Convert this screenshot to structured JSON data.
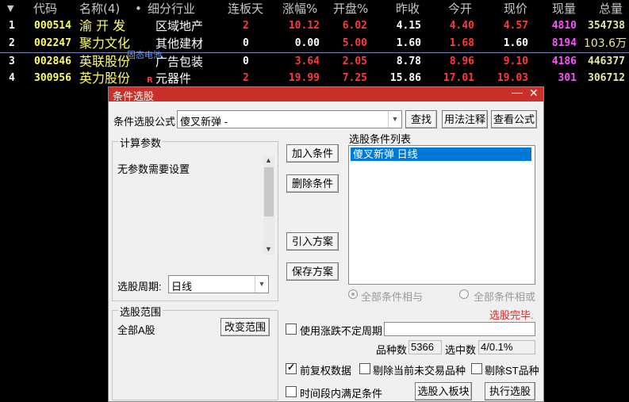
{
  "table": {
    "headers": [
      "代码",
      "名称(4)",
      "•",
      "细分行业",
      "连板天",
      "涨幅%",
      "开盘%",
      "昨收",
      "今开",
      "现价",
      "现量",
      "总量"
    ],
    "rows": [
      {
        "idx": "1",
        "code": "000514",
        "name": "渝 开 发",
        "mark": "",
        "industry": "区域地产",
        "lianban": "2",
        "zhangfu": "10.12",
        "kaipan": "6.02",
        "zuoshou": "4.15",
        "jinkai": "4.40",
        "xianjia": "4.57",
        "xianliang": "4810",
        "zongliang": "354738"
      },
      {
        "idx": "2",
        "code": "002247",
        "name": "聚力文化",
        "mark": "",
        "industry": "其他建材",
        "lianban": "0",
        "zhangfu": "0.00",
        "kaipan": "5.00",
        "zuoshou": "1.60",
        "jinkai": "1.68",
        "xianjia": "1.60",
        "xianliang": "8194",
        "zongliang": "103.6万"
      },
      {
        "idx": "3",
        "code": "002846",
        "name": "英联股份",
        "mark": "",
        "industry": "广告包装",
        "lianban": "0",
        "zhangfu": "3.64",
        "kaipan": "2.05",
        "zuoshou": "8.78",
        "jinkai": "8.96",
        "xianjia": "9.10",
        "xianliang": "4186",
        "zongliang": "446377"
      },
      {
        "idx": "4",
        "code": "300956",
        "name": "英力股份",
        "mark": "R",
        "industry": "元器件",
        "lianban": "2",
        "zhangfu": "19.99",
        "kaipan": "7.25",
        "zuoshou": "15.86",
        "jinkai": "17.01",
        "xianjia": "19.03",
        "xianliang": "301",
        "zongliang": "306712"
      }
    ],
    "tooltip": "固态电池",
    "colors": {
      "up": "#ff3a3a",
      "code": "#ffff64",
      "volume": "#ff50ff"
    }
  },
  "dialog": {
    "title": "条件选股",
    "formula_label": "条件选股公式",
    "formula_value": "傻叉新弹  -",
    "find_btn": "查找",
    "usage_btn": "用法注释",
    "view_btn": "查看公式",
    "params_legend": "计算参数",
    "params_text": "无参数需要设置",
    "add_btn": "加入条件",
    "delete_btn": "删除条件",
    "import_btn": "引入方案",
    "save_btn": "保存方案",
    "list_label": "选股条件列表",
    "list_items": [
      "傻叉新弹  日线"
    ],
    "period_label": "选股周期:",
    "period_value": "日线",
    "radio_and": "全部条件相与",
    "radio_or": "全部条件相或",
    "status": "选股完毕.",
    "range_legend": "选股范围",
    "range_value": "全部A股",
    "change_range_btn": "改变范围",
    "use_period_label": "使用涨跌不定周期",
    "count_label": "品种数",
    "count_value": "5366",
    "selected_label": "选中数",
    "selected_value": "4/0.1%",
    "fq_label": "前复权数据",
    "exclude_untraded_label": "剔除当前未交易品种",
    "exclude_st_label": "剔除ST品种",
    "time_label": "时间段内满足条件",
    "to_block_btn": "选股入板块",
    "run_btn": "执行选股",
    "colors": {
      "titlebar": "#c9302a",
      "status": "#e02020"
    }
  }
}
